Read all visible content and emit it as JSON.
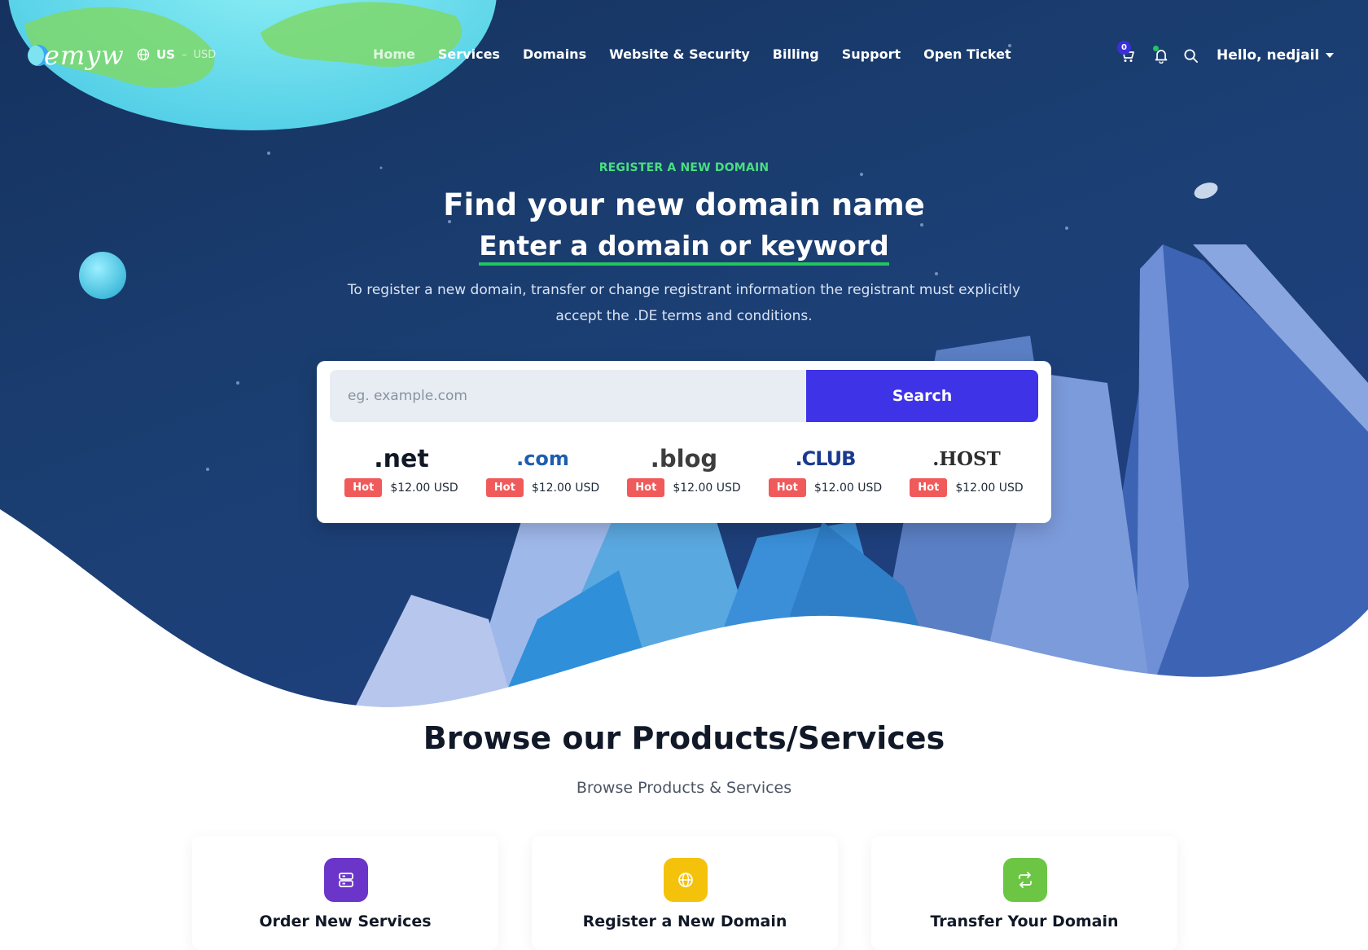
{
  "header": {
    "logo_text": "emyw",
    "locale": {
      "icon": "globe-icon",
      "region": "US",
      "currency": "USD"
    },
    "nav": [
      {
        "label": "Home",
        "active": true
      },
      {
        "label": "Services"
      },
      {
        "label": "Domains"
      },
      {
        "label": "Website & Security"
      },
      {
        "label": "Billing"
      },
      {
        "label": "Support"
      },
      {
        "label": "Open Ticket"
      }
    ],
    "cart_count": "0",
    "user_greeting": "Hello, nedjail"
  },
  "hero": {
    "kicker": "REGISTER A NEW DOMAIN",
    "title": "Find your new domain name",
    "subtitle": "Enter a domain or keyword",
    "description": "To register a new domain, transfer or change registrant information the registrant must explicitly accept the .DE terms and conditions.",
    "search": {
      "placeholder": "eg. example.com",
      "button_label": "Search"
    },
    "tlds": [
      {
        "name": ".net",
        "badge": "Hot",
        "price": "$12.00 USD"
      },
      {
        "name": ".com",
        "badge": "Hot",
        "price": "$12.00 USD"
      },
      {
        "name": ".blog",
        "badge": "Hot",
        "price": "$12.00 USD"
      },
      {
        "name": ".CLUB",
        "badge": "Hot",
        "price": "$12.00 USD"
      },
      {
        "name": ".HOST",
        "badge": "Hot",
        "price": "$12.00 USD"
      }
    ]
  },
  "browse": {
    "title": "Browse our Products/Services",
    "subtitle": "Browse Products & Services",
    "tiles": [
      {
        "label": "Order New Services",
        "icon": "server-icon",
        "color": "#6b35c9"
      },
      {
        "label": "Register a New Domain",
        "icon": "globe-icon",
        "color": "#f5c20b"
      },
      {
        "label": "Transfer Your Domain",
        "icon": "transfer-icon",
        "color": "#6cc644"
      }
    ]
  },
  "colors": {
    "accent": "#3f33e8",
    "kicker_green": "#4ade80",
    "hot_red": "#f05a5a",
    "hero_bg": "#1b3f73"
  }
}
